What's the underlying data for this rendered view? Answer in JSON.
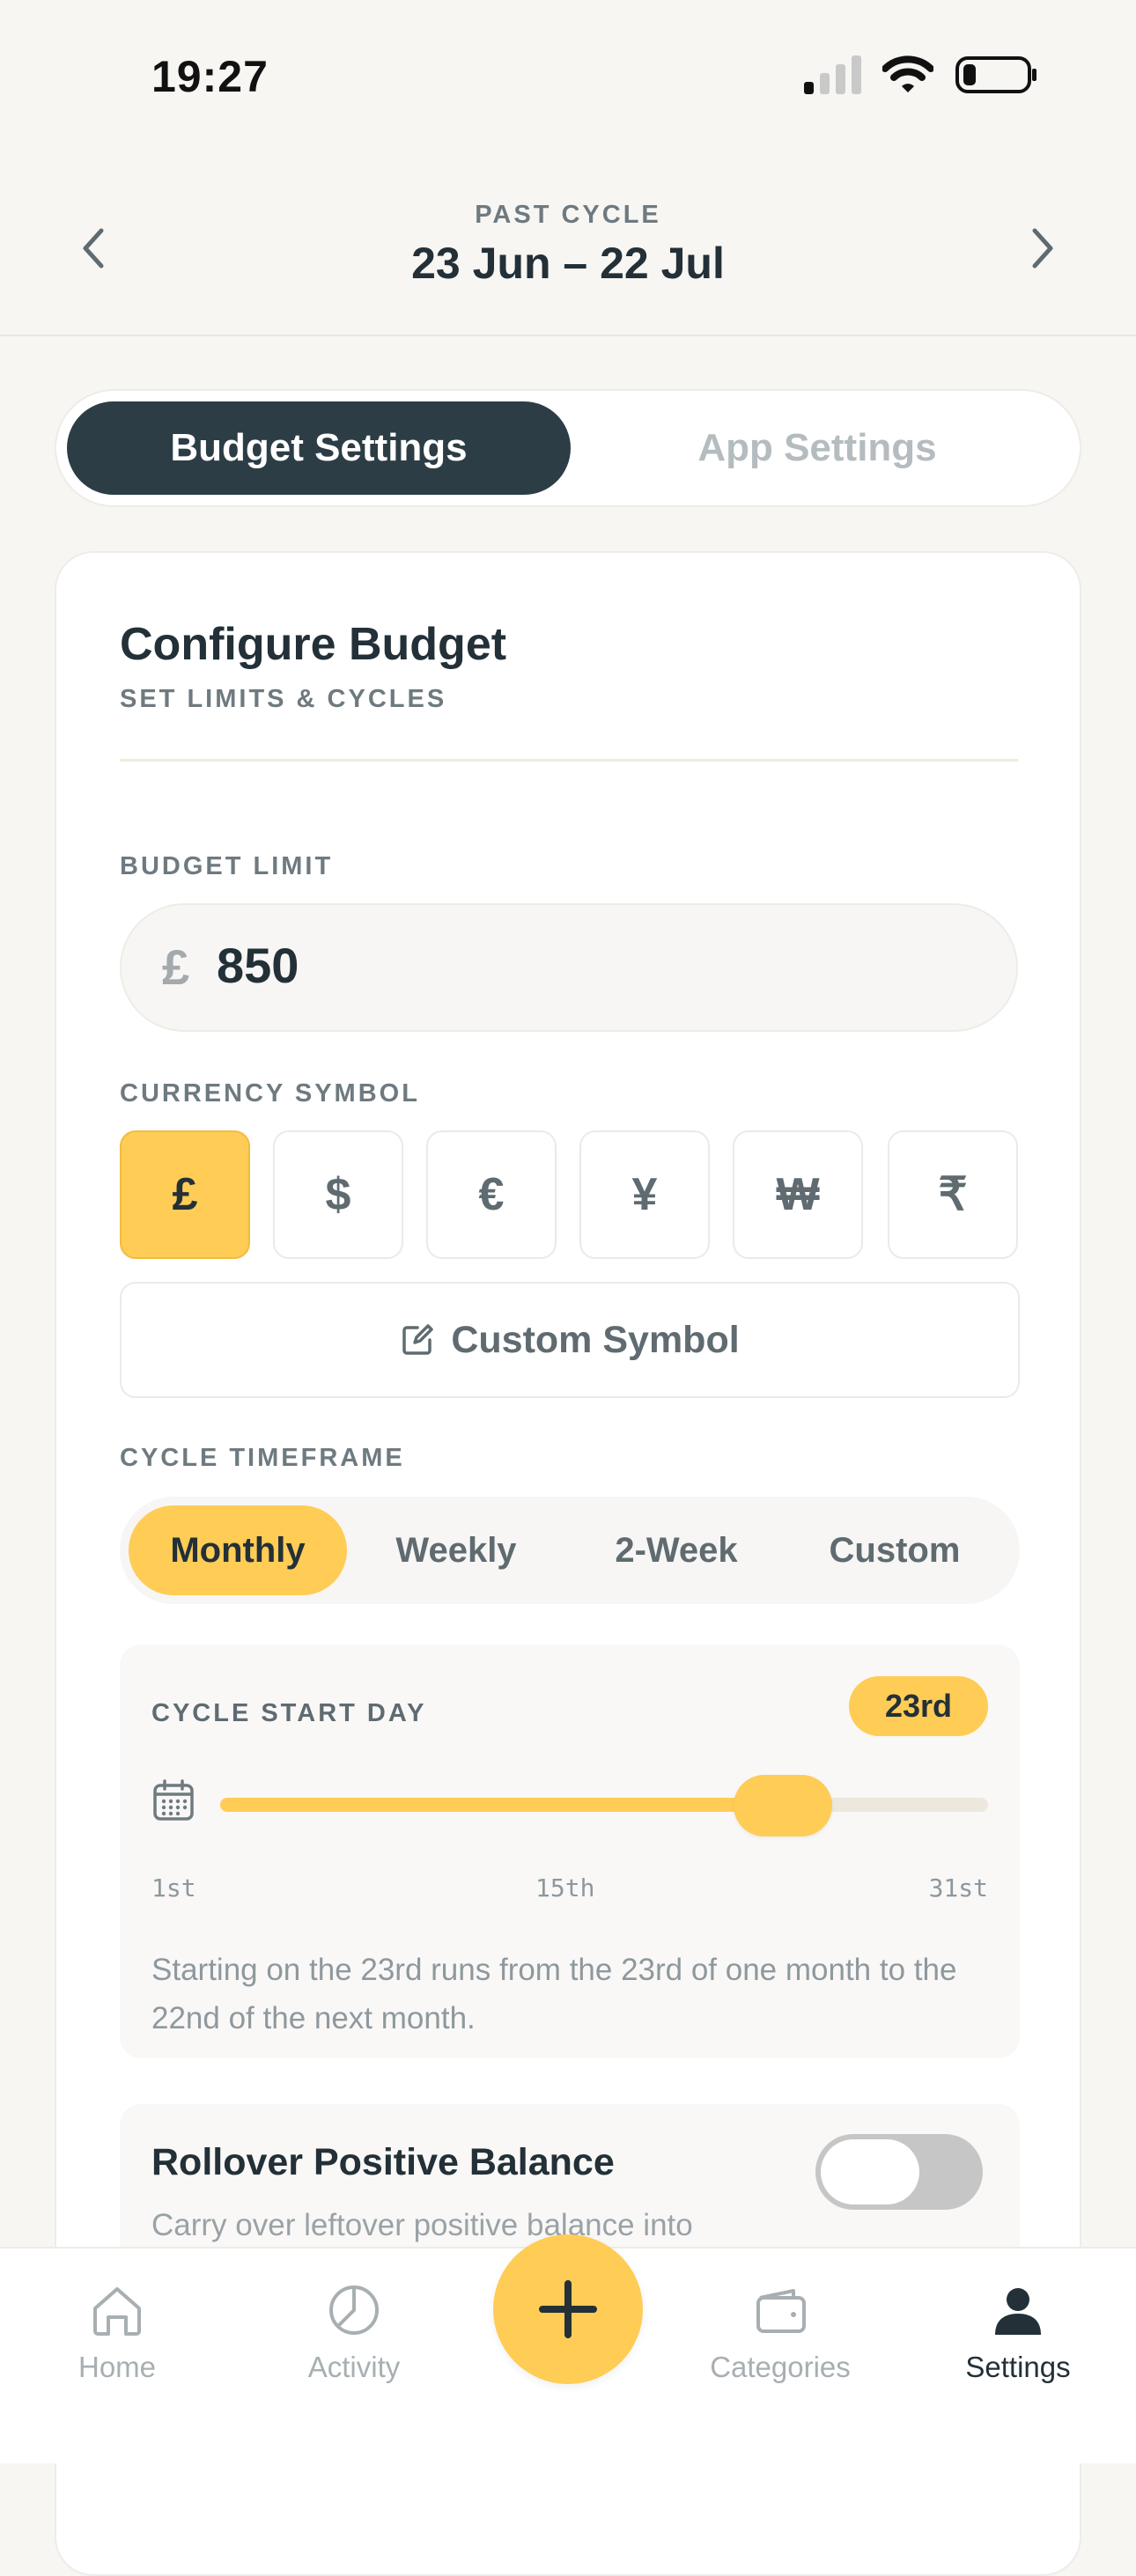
{
  "status_bar": {
    "time": "19:27"
  },
  "header": {
    "cycle_label": "PAST CYCLE",
    "cycle_range": "23 Jun – 22 Jul"
  },
  "tabs": [
    {
      "label": "Budget Settings",
      "active": true
    },
    {
      "label": "App Settings",
      "active": false
    }
  ],
  "card": {
    "title": "Configure Budget",
    "subtitle": "SET LIMITS & CYCLES",
    "budget_limit": {
      "label": "BUDGET LIMIT",
      "symbol": "£",
      "value": "850"
    },
    "currency": {
      "label": "CURRENCY SYMBOL",
      "options": [
        "£",
        "$",
        "€",
        "¥",
        "₩",
        "₹"
      ],
      "selected": "£",
      "custom_label": "Custom Symbol"
    },
    "timeframe": {
      "label": "CYCLE TIMEFRAME",
      "options": [
        "Monthly",
        "Weekly",
        "2-Week",
        "Custom"
      ],
      "selected": "Monthly"
    },
    "start_day": {
      "label": "CYCLE START DAY",
      "badge": "23rd",
      "value": 23,
      "min": 1,
      "max": 31,
      "ticks": [
        "1st",
        "15th",
        "31st"
      ],
      "description": "Starting on the 23rd runs from the 23rd of one month to the 22nd of the next month."
    },
    "rollover": {
      "title": "Rollover Positive Balance",
      "description": "Carry over leftover positive balance into",
      "enabled": false
    }
  },
  "bottom_nav": {
    "items": [
      {
        "label": "Home",
        "icon": "home-icon"
      },
      {
        "label": "Activity",
        "icon": "pie-chart-icon"
      },
      {
        "label": "Categories",
        "icon": "wallet-icon"
      },
      {
        "label": "Settings",
        "icon": "user-icon",
        "active": true
      }
    ],
    "add_icon": "plus-icon"
  },
  "colors": {
    "accent": "#FFCC55",
    "dark": "#2D3D46",
    "text": "#233038",
    "muted": "#6E7A80"
  }
}
